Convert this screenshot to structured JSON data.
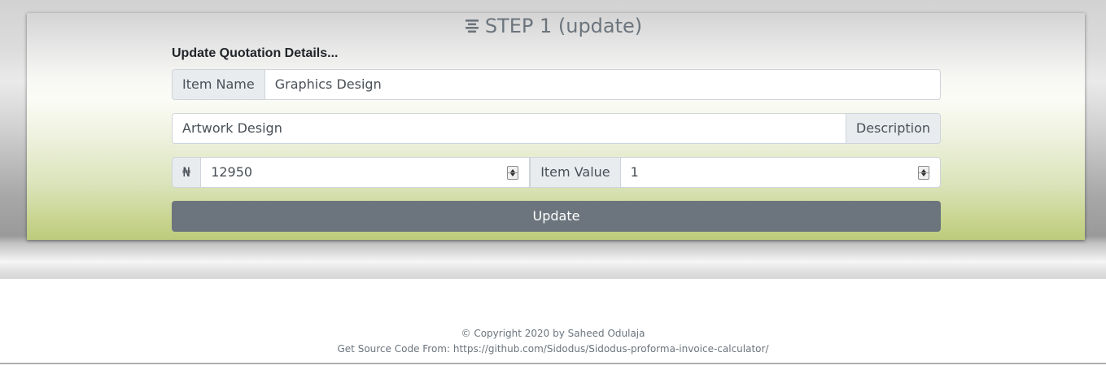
{
  "step": {
    "title": "STEP 1 (update)",
    "icon": "align-center-icon"
  },
  "form": {
    "heading": "Update Quotation Details...",
    "item_name_label": "Item Name",
    "item_name_value": "Graphics Design",
    "description_value": "Artwork Design",
    "description_label": "Description",
    "currency_symbol": "₦",
    "amount_value": "12950",
    "item_value_label": "Item Value",
    "item_value_value": "1",
    "update_label": "Update"
  },
  "footer": {
    "copyright": "© Copyright 2020 by Saheed Odulaja",
    "source": "Get Source Code From: https://github.com/Sidodus/Sidodus-proforma-invoice-calculator/"
  },
  "colors": {
    "button": "#6c757d",
    "card_bottom": "#bccb7c",
    "addon_bg": "#e9ecef"
  }
}
